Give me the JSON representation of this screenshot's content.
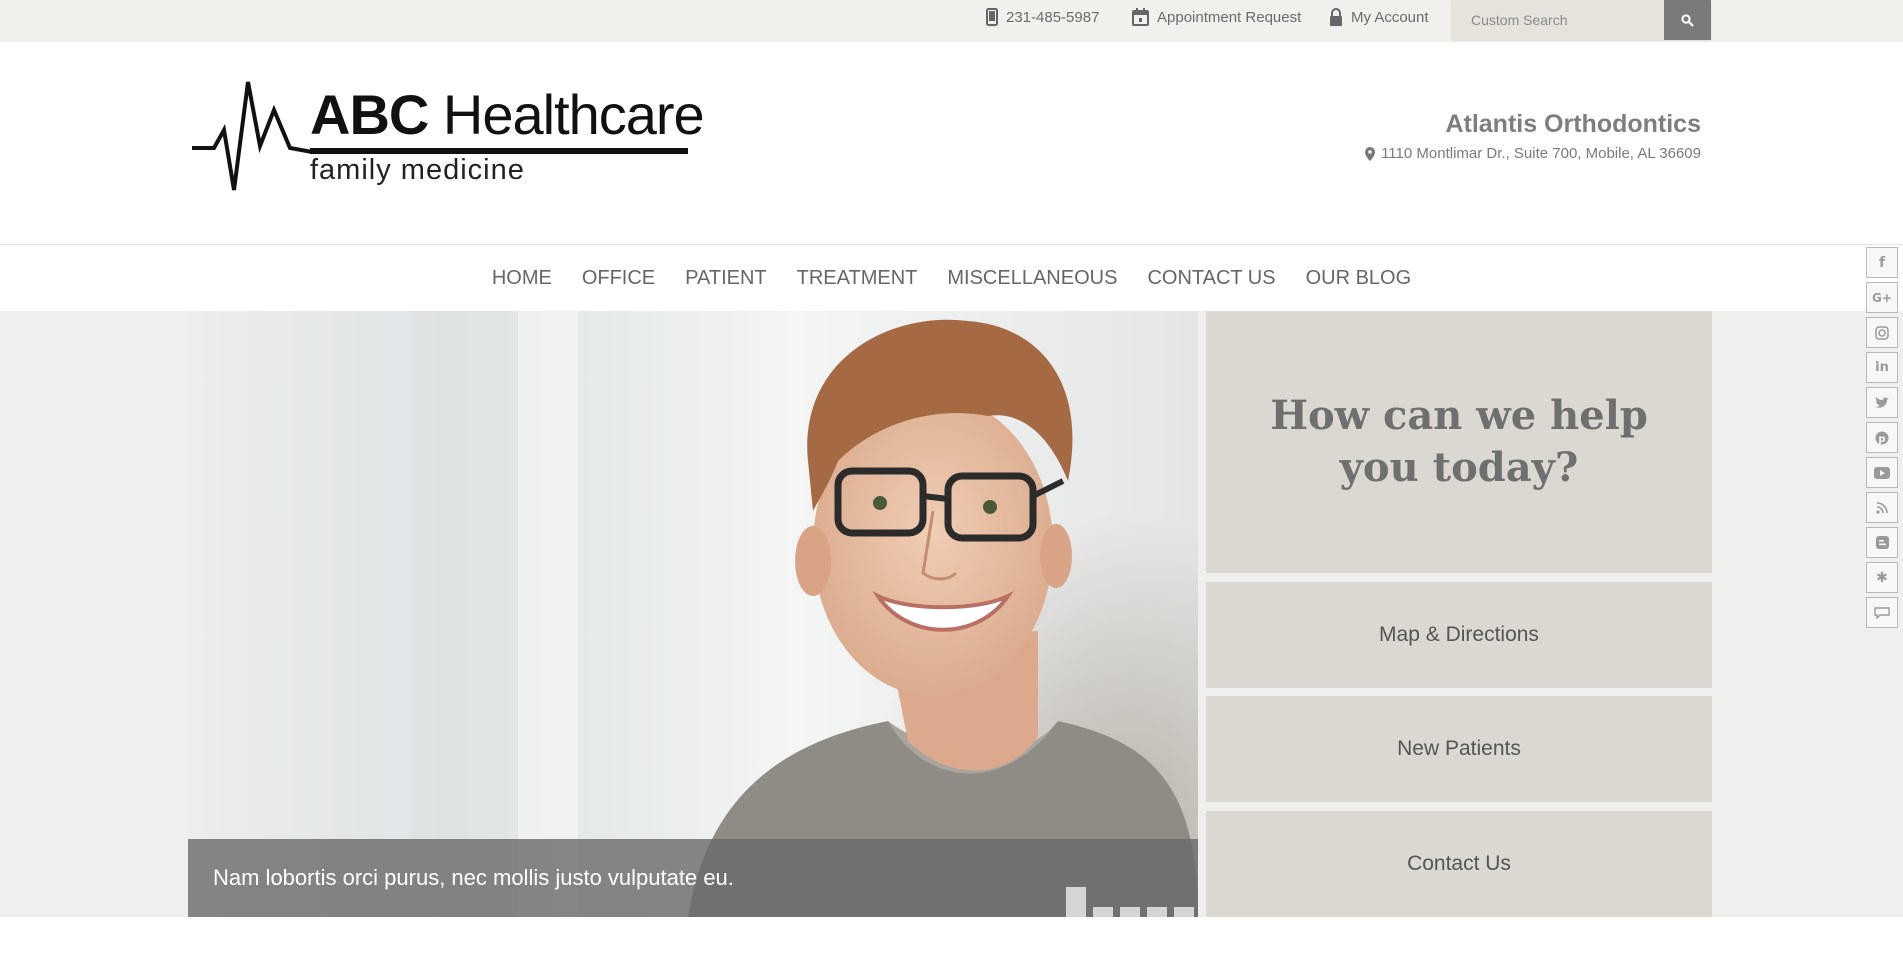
{
  "topbar": {
    "phone": "231-485-5987",
    "appointment": "Appointment Request",
    "account": "My Account",
    "search_placeholder": "Custom Search"
  },
  "header": {
    "brand_bold": "ABC",
    "brand_light": "Healthcare",
    "brand_sub": "family medicine",
    "practice_name": "Atlantis Orthodontics",
    "practice_address": "1110 Montlimar Dr., Suite 700, Mobile, AL 36609"
  },
  "nav": {
    "items": [
      "HOME",
      "OFFICE",
      "PATIENT",
      "TREATMENT",
      "MISCELLANEOUS",
      "CONTACT US",
      "OUR BLOG"
    ]
  },
  "hero": {
    "caption": "Nam lobortis orci purus, nec mollis justo vulputate eu.",
    "slide_count": 5,
    "active_slide": 1
  },
  "panels": {
    "help_title": "How can we help you today?",
    "links": [
      "Map & Directions",
      "New Patients",
      "Contact Us"
    ]
  },
  "social": {
    "icons": [
      "facebook-icon",
      "google-plus-icon",
      "instagram-icon",
      "linkedin-icon",
      "twitter-icon",
      "pinterest-icon",
      "youtube-icon",
      "rss-icon",
      "blogger-icon",
      "yelp-icon",
      "review-icon"
    ]
  }
}
